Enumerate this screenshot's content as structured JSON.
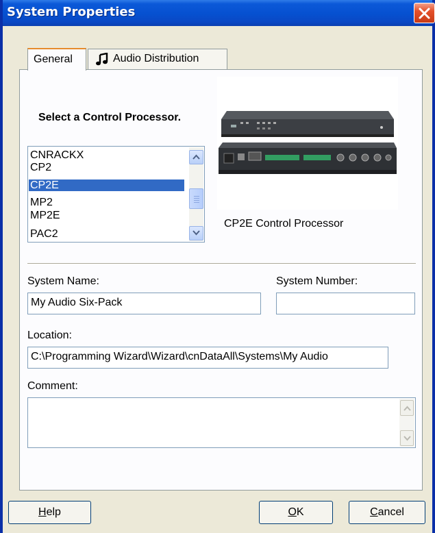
{
  "window": {
    "title": "System Properties"
  },
  "tabs": [
    {
      "label": "General",
      "active": true
    },
    {
      "label": "Audio Distribution",
      "icon": "music-note-icon"
    }
  ],
  "processor": {
    "heading": "Select a Control Processor.",
    "items": [
      "CNRACKX",
      "CP2",
      "CP2E",
      "MP2",
      "MP2E",
      "PAC2"
    ],
    "selected": "CP2E",
    "image_caption": "CP2E Control Processor"
  },
  "form": {
    "system_name_label": "System Name:",
    "system_name_value": "My Audio Six-Pack",
    "system_number_label": "System Number:",
    "system_number_value": "",
    "location_label": "Location:",
    "location_value": "C:\\Programming Wizard\\Wizard\\cnDataAll\\Systems\\My Audio",
    "comment_label": "Comment:",
    "comment_value": ""
  },
  "buttons": {
    "help_first": "H",
    "help_rest": "elp",
    "ok_first": "O",
    "ok_rest": "K",
    "cancel_first": "C",
    "cancel_rest": "ancel"
  },
  "colors": {
    "titlebar": "#0650d0",
    "selection": "#316ac5",
    "face": "#ece9d8"
  }
}
